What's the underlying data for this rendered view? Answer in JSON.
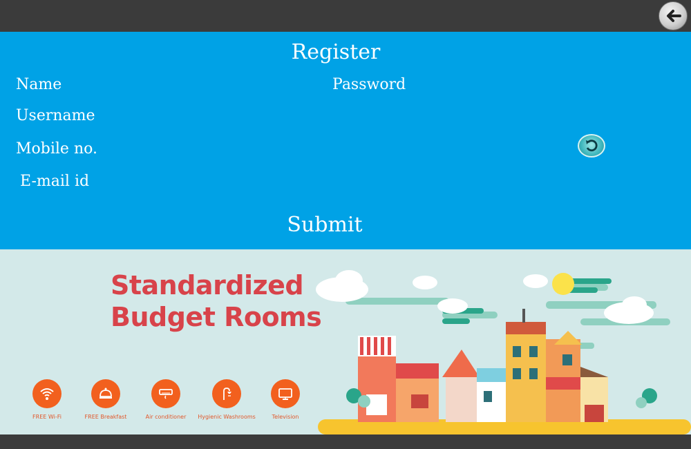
{
  "form": {
    "title": "Register",
    "labels": {
      "name": "Name",
      "password": "Password",
      "username": "Username",
      "mobile": "Mobile no.",
      "email": "E-mail id"
    },
    "submit_label": "Submit"
  },
  "banner": {
    "headline_line1": "Standardized",
    "headline_line2": "Budget Rooms",
    "amenities": [
      "FREE Wi-Fi",
      "FREE Breakfast",
      "Air conditioner",
      "Hygienic Washrooms",
      "Television"
    ]
  },
  "icons": {
    "back": "back-arrow-icon",
    "refresh": "refresh-icon"
  },
  "colors": {
    "form_background": "#00a2e6",
    "banner_background": "#d3e9e9",
    "headline": "#d8434a",
    "amenity": "#f2601e",
    "chrome": "#3b3b3b"
  }
}
